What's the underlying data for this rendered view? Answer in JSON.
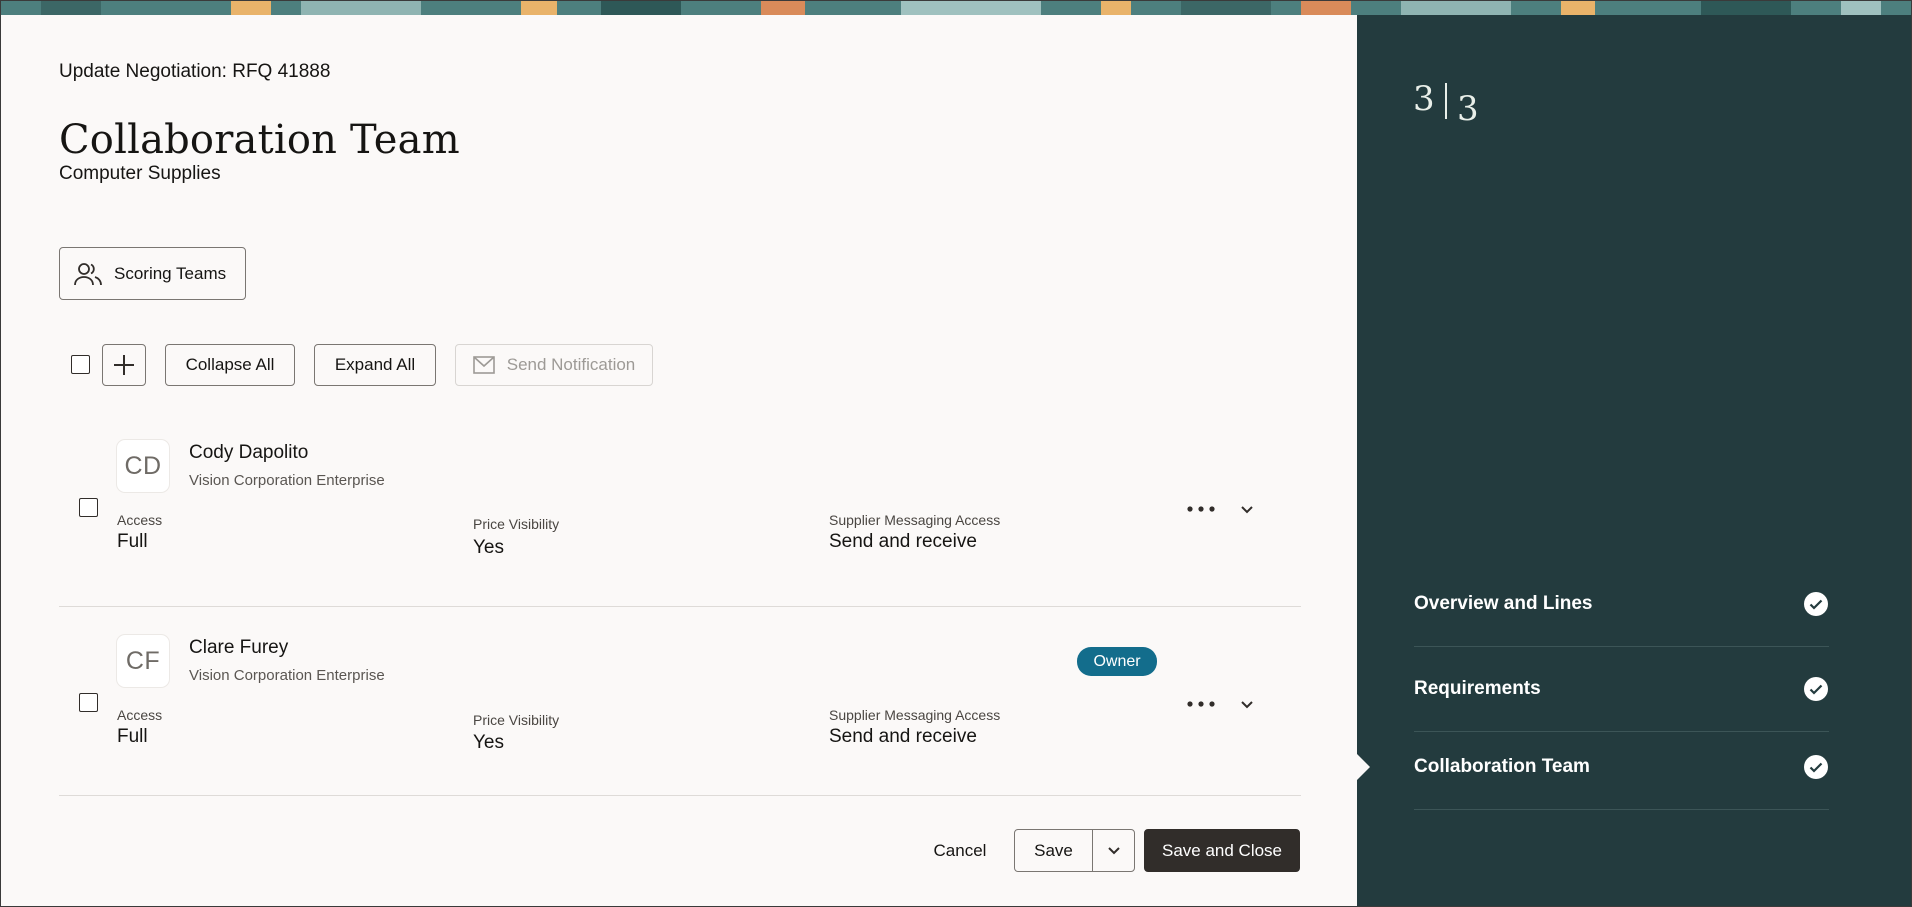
{
  "page": {
    "breadcrumb": "Update Negotiation: RFQ 41888",
    "title": "Collaboration Team",
    "subtitle": "Computer Supplies"
  },
  "toolbar": {
    "scoring_teams_label": "Scoring Teams",
    "collapse_all_label": "Collapse All",
    "expand_all_label": "Expand All",
    "send_notification_label": "Send Notification"
  },
  "members": [
    {
      "initials": "CD",
      "name": "Cody Dapolito",
      "org": "Vision Corporation Enterprise",
      "access_label": "Access",
      "access": "Full",
      "price_visibility_label": "Price Visibility",
      "price_visibility": "Yes",
      "supplier_messaging_label": "Supplier Messaging Access",
      "supplier_messaging": "Send and receive",
      "badge": ""
    },
    {
      "initials": "CF",
      "name": "Clare Furey",
      "org": "Vision Corporation Enterprise",
      "access_label": "Access",
      "access": "Full",
      "price_visibility_label": "Price Visibility",
      "price_visibility": "Yes",
      "supplier_messaging_label": "Supplier Messaging Access",
      "supplier_messaging": "Send and receive",
      "badge": "Owner"
    }
  ],
  "footer": {
    "cancel_label": "Cancel",
    "save_label": "Save",
    "save_close_label": "Save and Close"
  },
  "sidebar": {
    "logo_left": "3",
    "logo_right": "3",
    "steps": [
      {
        "label": "Overview and Lines",
        "status": "complete"
      },
      {
        "label": "Requirements",
        "status": "complete"
      },
      {
        "label": "Collaboration Team",
        "status": "complete",
        "current": true
      }
    ]
  },
  "colors": {
    "sidebar_bg": "#233b3e",
    "main_bg": "#fbf9f8",
    "primary_button": "#312d2a",
    "owner_badge": "#136d8c"
  }
}
